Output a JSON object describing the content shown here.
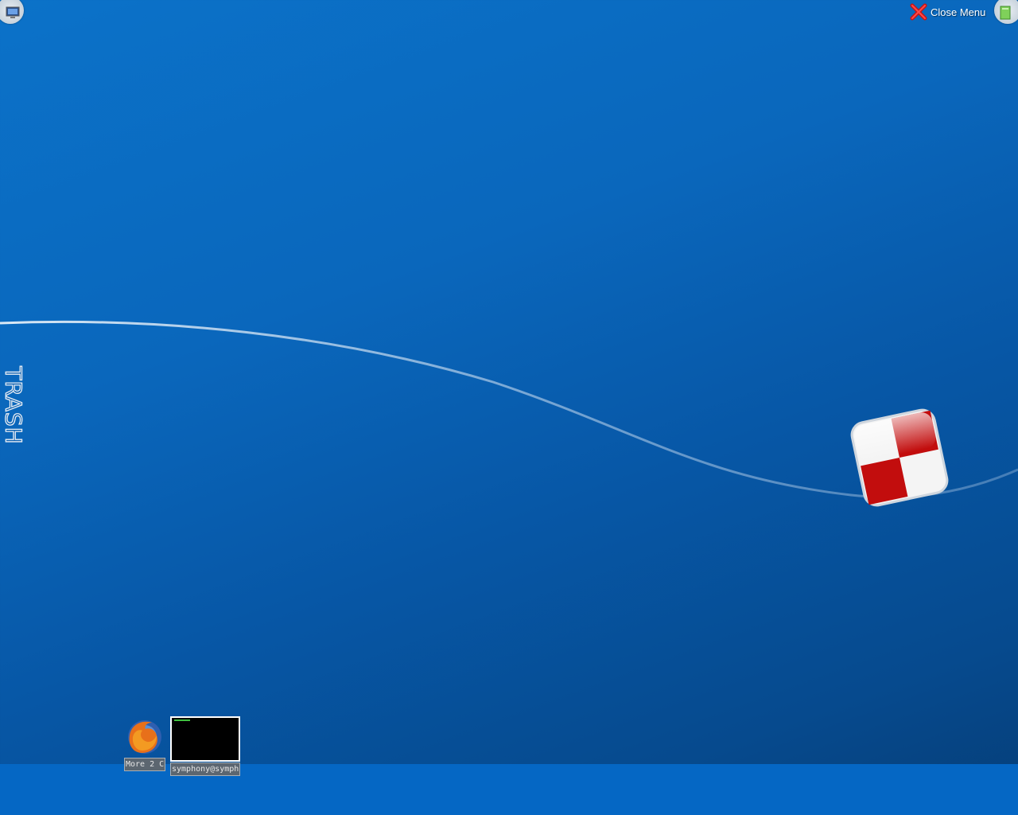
{
  "desktop": {
    "background_color": "#0a67bc",
    "trash_label": "TRASH"
  },
  "top_right_menu": {
    "close_label": "Close Menu",
    "close_icon": "red-x-icon"
  },
  "corners": {
    "top_left_icon": "computer-icon",
    "top_right_icon": "document-icon",
    "bottom_left_icon": "refresh-icon",
    "bottom_right_icon": "recycle-icon"
  },
  "taskbar": {
    "items": [
      {
        "label": "More 2 C",
        "icon": "firefox-icon"
      },
      {
        "label": "symphony@symph",
        "icon": "terminal-thumbnail"
      }
    ]
  },
  "logo": {
    "icon": "red-white-checkered-logo"
  }
}
